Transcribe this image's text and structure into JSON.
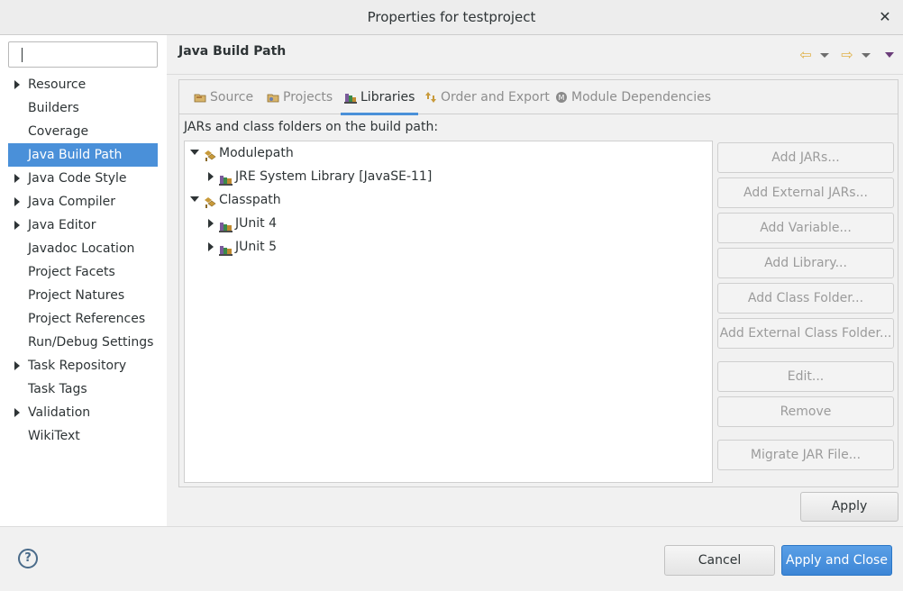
{
  "window": {
    "title": "Properties for testproject",
    "close_glyph": "✕"
  },
  "search": {
    "value": ""
  },
  "sidebar": {
    "items": [
      {
        "label": "Resource",
        "expandable": true
      },
      {
        "label": "Builders",
        "expandable": false
      },
      {
        "label": "Coverage",
        "expandable": false
      },
      {
        "label": "Java Build Path",
        "expandable": false,
        "selected": true
      },
      {
        "label": "Java Code Style",
        "expandable": true
      },
      {
        "label": "Java Compiler",
        "expandable": true
      },
      {
        "label": "Java Editor",
        "expandable": true
      },
      {
        "label": "Javadoc Location",
        "expandable": false
      },
      {
        "label": "Project Facets",
        "expandable": false
      },
      {
        "label": "Project Natures",
        "expandable": false
      },
      {
        "label": "Project References",
        "expandable": false
      },
      {
        "label": "Run/Debug Settings",
        "expandable": false
      },
      {
        "label": "Task Repository",
        "expandable": true
      },
      {
        "label": "Task Tags",
        "expandable": false
      },
      {
        "label": "Validation",
        "expandable": true
      },
      {
        "label": "WikiText",
        "expandable": false
      }
    ]
  },
  "page": {
    "title": "Java Build Path",
    "nav_icons": [
      "back-arrow-icon",
      "dropdown-icon",
      "forward-arrow-icon",
      "dropdown-icon",
      "view-menu-icon"
    ]
  },
  "tabs": [
    {
      "label": "Source",
      "icon": "source-folder-icon",
      "active": false
    },
    {
      "label": "Projects",
      "icon": "projects-icon",
      "active": false
    },
    {
      "label": "Libraries",
      "icon": "libraries-icon",
      "active": true
    },
    {
      "label": "Order and Export",
      "icon": "order-export-icon",
      "active": false
    },
    {
      "label": "Module Dependencies",
      "icon": "module-icon",
      "active": false
    }
  ],
  "libraries": {
    "description": "JARs and class folders on the build path:",
    "tree": [
      {
        "label": "Modulepath",
        "level": 0,
        "expanded": true,
        "icon": "modulepath-icon"
      },
      {
        "label": "JRE System Library [JavaSE-11]",
        "level": 1,
        "expanded": false,
        "icon": "library-icon"
      },
      {
        "label": "Classpath",
        "level": 0,
        "expanded": true,
        "icon": "classpath-icon"
      },
      {
        "label": "JUnit 4",
        "level": 1,
        "expanded": false,
        "icon": "library-icon"
      },
      {
        "label": "JUnit 5",
        "level": 1,
        "expanded": false,
        "icon": "library-icon"
      }
    ],
    "buttons": {
      "add_jars": "Add JARs...",
      "add_external_jars": "Add External JARs...",
      "add_variable": "Add Variable...",
      "add_library": "Add Library...",
      "add_class_folder": "Add Class Folder...",
      "add_external_class_folder": "Add External Class Folder...",
      "edit": "Edit...",
      "remove": "Remove",
      "migrate_jar": "Migrate JAR File..."
    }
  },
  "actions": {
    "apply": "Apply",
    "cancel": "Cancel",
    "apply_and_close": "Apply and Close",
    "help_glyph": "?"
  },
  "colors": {
    "selection": "#4a90d9",
    "primary_button": "#3d86d6",
    "disabled_text": "#9b9b9b"
  }
}
